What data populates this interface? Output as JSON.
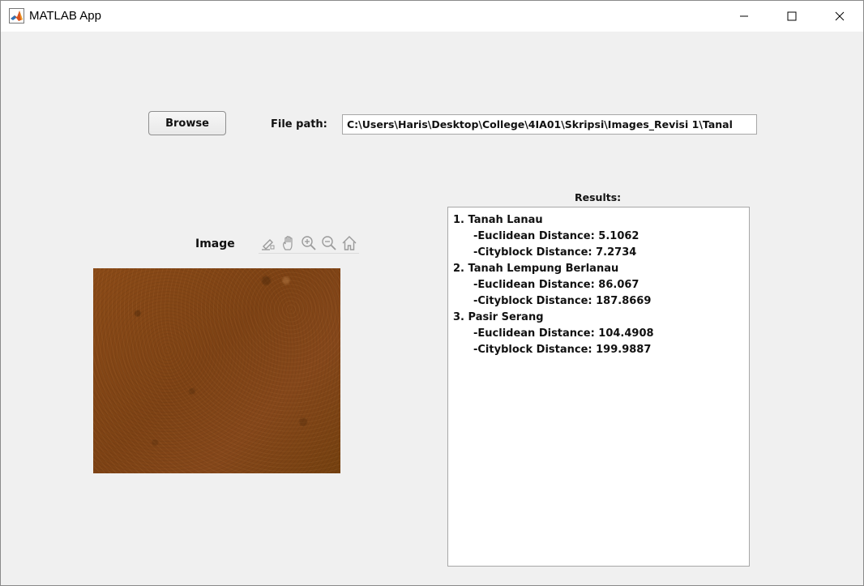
{
  "window": {
    "title": "MATLAB App",
    "icon": "matlab-logo-icon",
    "controls": [
      "minimize-icon",
      "maximize-icon",
      "close-icon"
    ]
  },
  "browse": {
    "label": "Browse"
  },
  "file_path": {
    "label": "File path:",
    "value": "C:\\Users\\Haris\\Desktop\\College\\4IA01\\Skripsi\\Images_Revisi 1\\Tanal"
  },
  "image_panel": {
    "title": "Image",
    "toolbar": [
      "brush-icon",
      "pan-hand-icon",
      "zoom-in-icon",
      "zoom-out-icon",
      "home-icon"
    ],
    "image_description_color": "#7f4415"
  },
  "results": {
    "label": "Results:",
    "lines": [
      {
        "text": "1. Tanah Lanau",
        "indent": false
      },
      {
        "text": "-Euclidean Distance: 5.1062",
        "indent": true
      },
      {
        "text": "-Cityblock Distance: 7.2734",
        "indent": true
      },
      {
        "text": "2. Tanah Lempung Berlanau",
        "indent": false
      },
      {
        "text": "-Euclidean Distance: 86.067",
        "indent": true
      },
      {
        "text": "-Cityblock Distance: 187.8669",
        "indent": true
      },
      {
        "text": "3. Pasir Serang",
        "indent": false
      },
      {
        "text": "-Euclidean Distance: 104.4908",
        "indent": true
      },
      {
        "text": "-Cityblock Distance: 199.9887",
        "indent": true
      }
    ]
  }
}
